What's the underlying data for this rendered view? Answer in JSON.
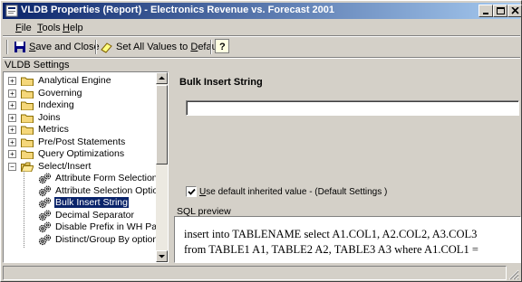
{
  "window": {
    "title": "VLDB Properties (Report) - Electronics Revenue vs. Forecast 2001",
    "colors": {
      "titlebar_start": "#0a246a",
      "titlebar_end": "#a6caf0",
      "chrome": "#d4d0c8",
      "selection": "#0a246a"
    }
  },
  "menu": {
    "file": {
      "accel": "F",
      "rest": "ile"
    },
    "tools": {
      "accel": "T",
      "rest": "ools"
    },
    "help": {
      "accel": "H",
      "rest": "elp"
    }
  },
  "toolbar": {
    "save_close": {
      "accel": "S",
      "rest": "ave and Close"
    },
    "set_default": {
      "pre": "Set All Values to ",
      "accel": "D",
      "rest": "efault"
    },
    "help_icon": "question-help-icon"
  },
  "settings_label": "VLDB Settings",
  "tree": {
    "folders": [
      {
        "label": "Analytical Engine",
        "expander": "+"
      },
      {
        "label": "Governing",
        "expander": "+"
      },
      {
        "label": "Indexing",
        "expander": "+"
      },
      {
        "label": "Joins",
        "expander": "+"
      },
      {
        "label": "Metrics",
        "expander": "+"
      },
      {
        "label": "Pre/Post Statements",
        "expander": "+"
      },
      {
        "label": "Query Optimizations",
        "expander": "+"
      },
      {
        "label": "Select/Insert",
        "expander": "−"
      }
    ],
    "children": [
      {
        "label": "Attribute Form Selection Op"
      },
      {
        "label": "Attribute Selection Option fo"
      },
      {
        "label": "Bulk Insert String",
        "selected": true
      },
      {
        "label": "Decimal Separator"
      },
      {
        "label": "Disable Prefix in WH Partitio"
      },
      {
        "label": "Distinct/Group By option (wh"
      }
    ]
  },
  "property": {
    "title": "Bulk Insert String",
    "value": "",
    "checkbox_checked": true,
    "checkbox_label_pre": "",
    "checkbox_label_accel": "U",
    "checkbox_label_rest": "se default inherited value - (Default Settings )"
  },
  "sql": {
    "label": "SQL preview",
    "line1": "insert into TABLENAME select A1.COL1, A2.COL2, A3.COL3",
    "line2": "from TABLE1 A1, TABLE2 A2, TABLE3 A3 where A1.COL1 ="
  }
}
